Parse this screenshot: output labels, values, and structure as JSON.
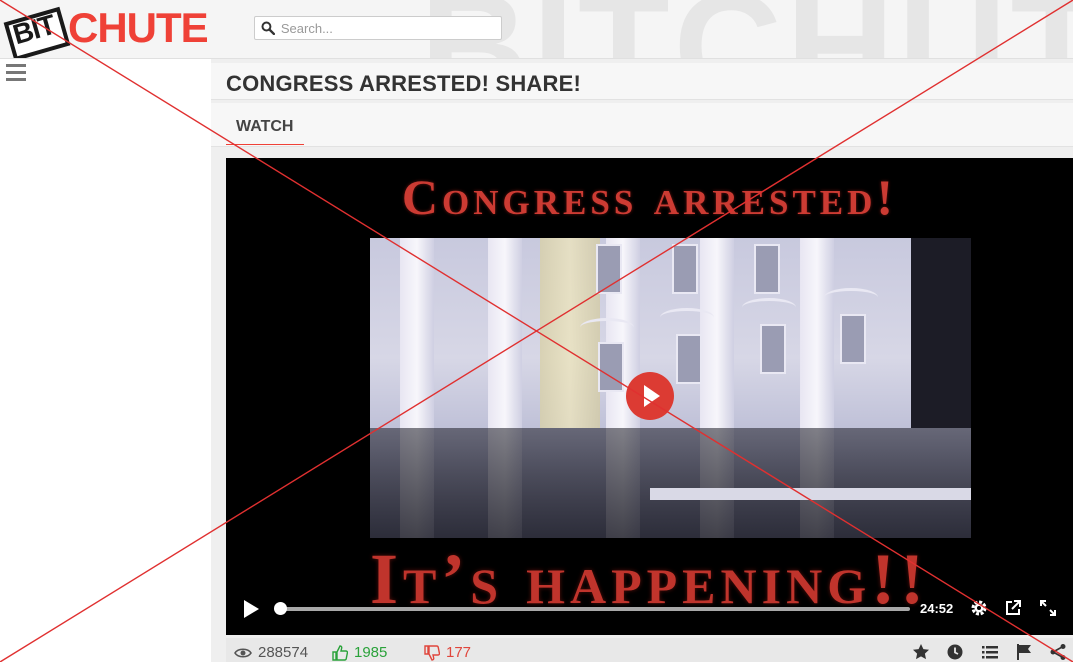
{
  "header": {
    "logo_bit": "BIT",
    "logo_chute": "CHUTE",
    "watermark": "BITCHUTE",
    "search_placeholder": "Search..."
  },
  "sidebar": {
    "menu_icon": "hamburger-menu-icon"
  },
  "video_page": {
    "title": "CONGRESS ARRESTED! SHARE!",
    "tabs": [
      {
        "label": "WATCH",
        "active": true
      }
    ]
  },
  "player": {
    "frame_top_text": "Congress arrested!",
    "frame_bottom_text": "It’s happening!!",
    "duration": "24:52",
    "progress": 0,
    "icons": [
      "play-icon",
      "settings-gear-icon",
      "popout-icon",
      "fullscreen-icon"
    ],
    "accent": "#dc3b33"
  },
  "stats": {
    "views": "288574",
    "likes": "1985",
    "dislikes": "177",
    "like_color": "#2aa23a",
    "dislike_color": "#e0463c",
    "actions": [
      "star-icon",
      "clock-icon",
      "list-icon",
      "flag-icon",
      "share-icon"
    ]
  },
  "overlay": {
    "type": "red-x",
    "color": "#e03030"
  },
  "brand_color": "#ef4137"
}
